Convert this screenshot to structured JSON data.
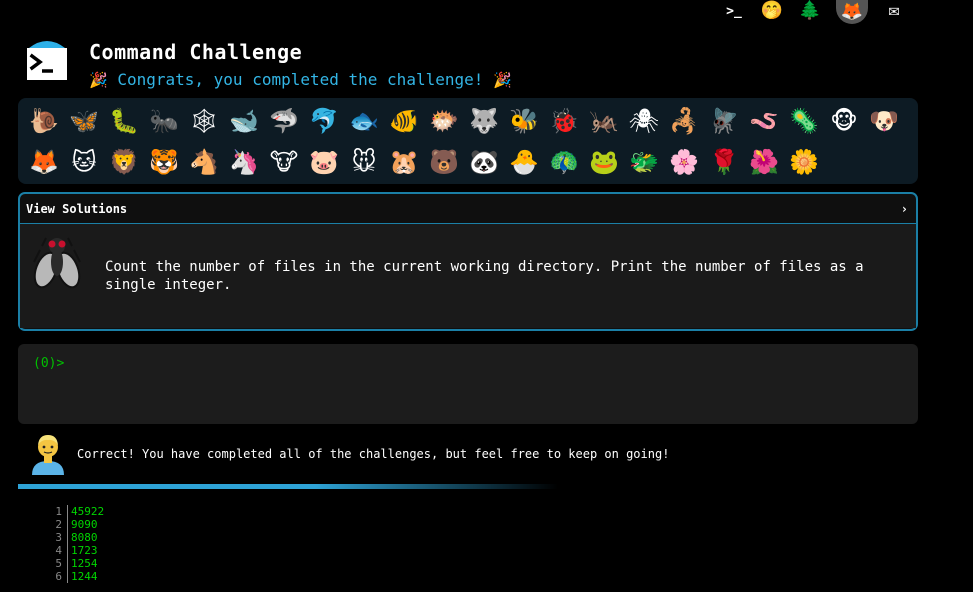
{
  "header": {
    "title": "Command Challenge",
    "subtitle": "Congrats, you completed the challenge!",
    "subtitle_emoji": "🎉",
    "top_icons": [
      {
        "name": "prompt-icon",
        "glyph": ">_"
      },
      {
        "name": "shush-face-icon",
        "glyph": "🤭"
      },
      {
        "name": "tree-icon",
        "glyph": "🌲"
      },
      {
        "name": "gitlab-icon",
        "glyph": "🦊"
      },
      {
        "name": "mail-icon",
        "glyph": "✉"
      }
    ]
  },
  "animals": [
    {
      "name": "snail",
      "glyph": "🐌"
    },
    {
      "name": "butterfly",
      "glyph": "🦋"
    },
    {
      "name": "caterpillar",
      "glyph": "🐛"
    },
    {
      "name": "ant",
      "glyph": "🐜"
    },
    {
      "name": "spider-web",
      "glyph": "🕸"
    },
    {
      "name": "whale",
      "glyph": "🐋"
    },
    {
      "name": "shark",
      "glyph": "🦈"
    },
    {
      "name": "dolphin",
      "glyph": "🐬"
    },
    {
      "name": "fish",
      "glyph": "🐟"
    },
    {
      "name": "tropical-fish",
      "glyph": "🐠"
    },
    {
      "name": "blowfish",
      "glyph": "🐡"
    },
    {
      "name": "wolf",
      "glyph": "🐺"
    },
    {
      "name": "bee",
      "glyph": "🐝"
    },
    {
      "name": "ladybug",
      "glyph": "🐞"
    },
    {
      "name": "cricket",
      "glyph": "🦗"
    },
    {
      "name": "spider",
      "glyph": "🕷"
    },
    {
      "name": "scorpion",
      "glyph": "🦂"
    },
    {
      "name": "fly",
      "glyph": "🪰"
    },
    {
      "name": "worm",
      "glyph": "🪱"
    },
    {
      "name": "microbe",
      "glyph": "🦠"
    },
    {
      "name": "monkey",
      "glyph": "🐵"
    },
    {
      "name": "dog",
      "glyph": "🐶"
    },
    {
      "name": "fox",
      "glyph": "🦊"
    },
    {
      "name": "cat",
      "glyph": "🐱"
    },
    {
      "name": "lion",
      "glyph": "🦁"
    },
    {
      "name": "tiger",
      "glyph": "🐯"
    },
    {
      "name": "horse",
      "glyph": "🐴"
    },
    {
      "name": "unicorn",
      "glyph": "🦄"
    },
    {
      "name": "cow",
      "glyph": "🐮"
    },
    {
      "name": "pig",
      "glyph": "🐷"
    },
    {
      "name": "mouse",
      "glyph": "🐭"
    },
    {
      "name": "hamster",
      "glyph": "🐹"
    },
    {
      "name": "bear",
      "glyph": "🐻"
    },
    {
      "name": "panda",
      "glyph": "🐼"
    },
    {
      "name": "hatching-chick",
      "glyph": "🐣"
    },
    {
      "name": "peacock",
      "glyph": "🦚"
    },
    {
      "name": "frog",
      "glyph": "🐸"
    },
    {
      "name": "dragon",
      "glyph": "🐲"
    },
    {
      "name": "cherry-blossom",
      "glyph": "🌸"
    },
    {
      "name": "rose",
      "glyph": "🌹"
    },
    {
      "name": "hibiscus",
      "glyph": "🌺"
    },
    {
      "name": "sunflower",
      "glyph": "🌼"
    }
  ],
  "challenge": {
    "view_solutions_label": "View Solutions",
    "chevron": "›",
    "description": "Count the number of files in the current working directory. Print the number of files as a single integer."
  },
  "terminal": {
    "prompt": "(0)>"
  },
  "result": {
    "message": "Correct! You have completed all of the challenges, but feel free to keep on going!"
  },
  "output": {
    "lines": [
      {
        "n": "1",
        "v": "45922"
      },
      {
        "n": "2",
        "v": "9090"
      },
      {
        "n": "3",
        "v": "8080"
      },
      {
        "n": "4",
        "v": "1723"
      },
      {
        "n": "5",
        "v": "1254"
      },
      {
        "n": "6",
        "v": "1244"
      }
    ]
  },
  "colors": {
    "accent": "#33b5e5",
    "border": "#1b7fa6",
    "prompt_green": "#00c000",
    "output_green": "#00d400",
    "panel_bg": "#0d1b24"
  }
}
